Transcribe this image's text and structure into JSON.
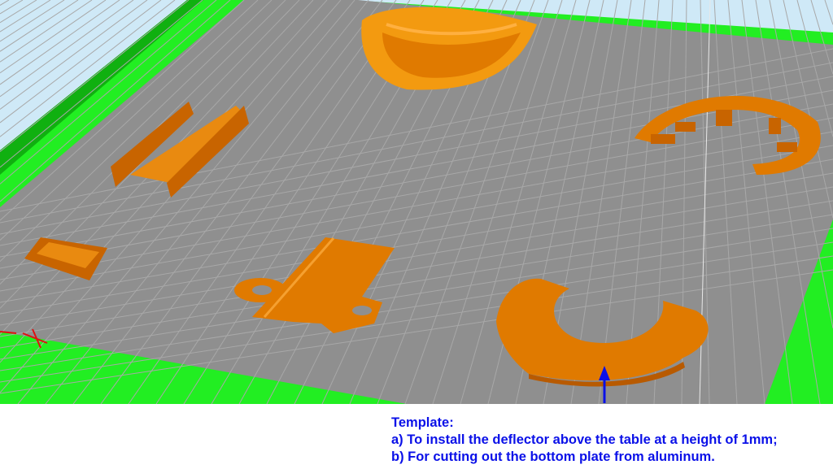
{
  "viewport": {
    "colors": {
      "sky": "#cfe9f7",
      "bed": "#8f8f8f",
      "grid": "#a8a8a8",
      "border": "#22ee22",
      "border_dark": "#10b010",
      "part": "#e07a00",
      "part_light": "#f39a10",
      "arrow": "#0a10e8"
    }
  },
  "caption": {
    "title": "Template:",
    "line_a": "a) To install the deflector above the table at a height of 1mm;",
    "line_b": "b) For cutting out the bottom plate from aluminum."
  }
}
